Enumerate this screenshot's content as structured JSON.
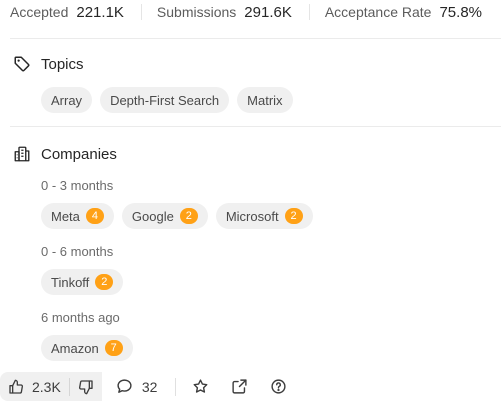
{
  "stats": {
    "accepted_label": "Accepted",
    "accepted_value": "221.1K",
    "submissions_label": "Submissions",
    "submissions_value": "291.6K",
    "acceptance_rate_label": "Acceptance Rate",
    "acceptance_rate_value": "75.8%"
  },
  "topics": {
    "title": "Topics",
    "icon": "tag-icon",
    "items": [
      "Array",
      "Depth-First Search",
      "Matrix"
    ]
  },
  "companies": {
    "title": "Companies",
    "icon": "building-icon",
    "groups": [
      {
        "period": "0 - 3 months",
        "items": [
          {
            "name": "Meta",
            "count": "4"
          },
          {
            "name": "Google",
            "count": "2"
          },
          {
            "name": "Microsoft",
            "count": "2"
          }
        ]
      },
      {
        "period": "0 - 6 months",
        "items": [
          {
            "name": "Tinkoff",
            "count": "2"
          }
        ]
      },
      {
        "period": "6 months ago",
        "items": [
          {
            "name": "Amazon",
            "count": "7"
          }
        ]
      }
    ]
  },
  "actions": {
    "likes": "2.3K",
    "comments": "32"
  },
  "colors": {
    "badge": "#ffa116",
    "chip_bg": "#f0f0f0"
  }
}
